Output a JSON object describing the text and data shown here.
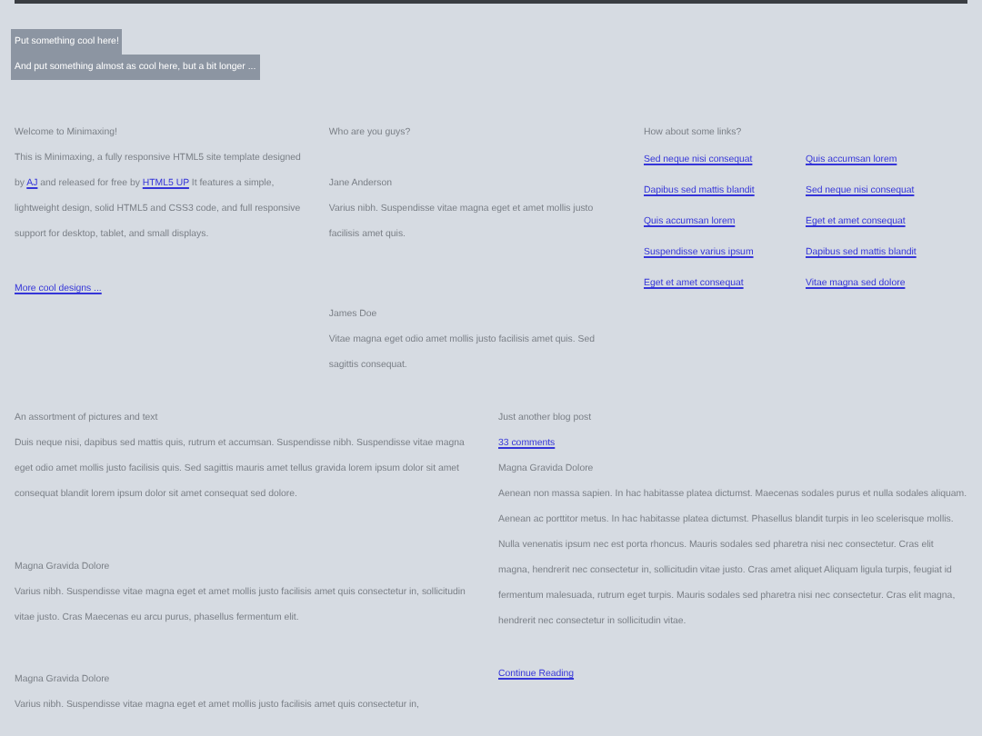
{
  "header": {
    "title": "Put something cool here!",
    "subtitle": "And put something almost as cool here, but a bit longer ..."
  },
  "welcome": {
    "heading": "Welcome to Minimaxing!",
    "text": [
      {
        "kind": "text",
        "text": "This is Minimaxing, a fully responsive HTML5 site template designed by "
      },
      {
        "kind": "link",
        "text": "AJ"
      },
      {
        "kind": "text",
        "text": " and released for free by "
      },
      {
        "kind": "link",
        "text": "HTML5 UP"
      },
      {
        "kind": "text",
        "text": " It features a simple, lightweight design, solid HTML5 and CSS3 code, and full responsive support for desktop, tablet, and small displays."
      }
    ],
    "more_link": "More cool designs ..."
  },
  "people": {
    "heading": "Who are you guys?",
    "members": [
      {
        "name": "Jane Anderson",
        "text": "Varius nibh. Suspendisse vitae magna eget et amet mollis justo facilisis amet quis."
      },
      {
        "name": "James Doe",
        "text": "Vitae magna eget odio amet mollis justo facilisis amet quis. Sed sagittis consequat."
      }
    ]
  },
  "links": {
    "heading": "How about some links?",
    "columns": [
      [
        "Sed neque nisi consequat",
        "Dapibus sed mattis blandit",
        "Quis accumsan lorem",
        "Suspendisse varius ipsum",
        "Eget et amet consequat"
      ],
      [
        "Quis accumsan lorem",
        "Sed neque nisi consequat",
        "Eget et amet consequat",
        "Dapibus sed mattis blandit",
        "Vitae magna sed dolore"
      ]
    ]
  },
  "assortment": {
    "heading": "An assortment of pictures and text",
    "text": "Duis neque nisi, dapibus sed mattis quis, rutrum et accumsan. Suspendisse nibh. Suspendisse vitae magna eget odio amet mollis justo facilisis quis. Sed sagittis mauris amet tellus gravida lorem ipsum dolor sit amet consequat blandit lorem ipsum dolor sit amet consequat sed dolore.",
    "items": [
      {
        "title": "Magna Gravida Dolore",
        "text": "Varius nibh. Suspendisse vitae magna eget et amet mollis justo facilisis amet quis consectetur in, sollicitudin vitae justo. Cras Maecenas eu arcu purus, phasellus fermentum elit."
      },
      {
        "title": "Magna Gravida Dolore",
        "text": "Varius nibh. Suspendisse vitae magna eget et amet mollis justo facilisis amet quis consectetur in,"
      }
    ]
  },
  "blog": {
    "heading": "Just another blog post",
    "comments": "33 comments",
    "title": "Magna Gravida Dolore",
    "text": "Aenean non massa sapien. In hac habitasse platea dictumst. Maecenas sodales purus et nulla sodales aliquam. Aenean ac porttitor metus. In hac habitasse platea dictumst. Phasellus blandit turpis in leo scelerisque mollis. Nulla venenatis ipsum nec est porta rhoncus. Mauris sodales sed pharetra nisi nec consectetur. Cras elit magna, hendrerit nec consectetur in, sollicitudin vitae justo. Cras amet aliquet Aliquam ligula turpis, feugiat id fermentum malesuada, rutrum eget turpis. Mauris sodales sed pharetra nisi nec consectetur. Cras elit magna, hendrerit nec consectetur in sollicitudin vitae.",
    "continue": "Continue Reading"
  }
}
